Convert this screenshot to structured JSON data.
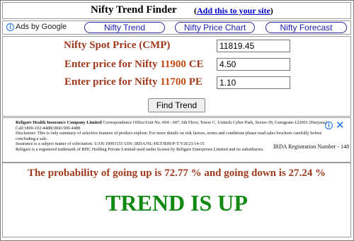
{
  "header": {
    "title": "Nifty Trend Finder",
    "link_label": "Add this to your site",
    "open_paren": "(",
    "close_paren": ")"
  },
  "ads_bar": {
    "label": "Ads by Google",
    "info_icon": "info-icon",
    "links": [
      "Nifty Trend",
      "Nifty Price Chart",
      "Nifty Forecast"
    ]
  },
  "form": {
    "spot_label": "Nifty Spot Price (CMP)",
    "spot_value": "11819.45",
    "ce_prefix": "Enter price for Nifty",
    "ce_strike": "11900",
    "ce_suffix": "CE",
    "ce_value": "4.50",
    "pe_prefix": "Enter price for Nifty",
    "pe_strike": "11700",
    "pe_suffix": "PE",
    "pe_value": "1.10",
    "button_label": "Find Trend"
  },
  "ad": {
    "company": "Religare Health Insurance Company Limited",
    "line1": "Correspondence Office:Unit No. 604 - 607, 6th Floor, Tower C, Unitech Cyber Park, Sector-39, Gurugram-122001 (Haryana) Call:1800-102-4488|1860-500-4488",
    "line2": "Disclaimer: This is only summary of selective features of product",
    "line2_link": "explore",
    "line2_rest": ". For more details on risk factors, terms and conditions please read sales brochure carefully before concluding a sale.",
    "line3": "Insurance is a subject matter of solicitation.    UAN:19093155  UIN: IRDA/NL-HLT/RHI/P-T/V.II/23/14-15",
    "registration": "IRDA Registration Number - 148",
    "line4": "Religare is a registered trademark of RHC Holding Private Limited used under license by Religare Enterprises Limited  and its subsidiaries.",
    "info_icon": "info-icon",
    "close_icon": "close-icon"
  },
  "result": {
    "probability_text": "The probability of going up is 72.77 % and going down is 27.24 %",
    "trend_text": "TREND IS UP"
  },
  "colors": {
    "label_brown": "#a0391c",
    "trend_green": "#138a13",
    "link_blue": "#0000cc"
  }
}
